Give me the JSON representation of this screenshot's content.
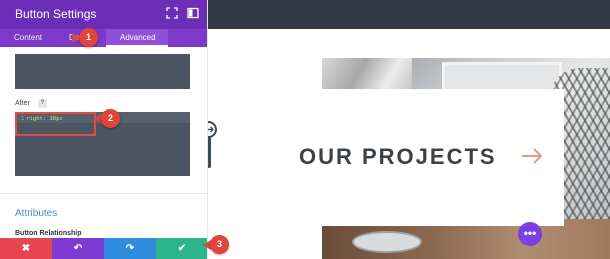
{
  "panel": {
    "title": "Button Settings",
    "header_icons": [
      "expand-icon",
      "sidebar-toggle-icon"
    ],
    "tabs": [
      {
        "label": "Content",
        "active": false
      },
      {
        "label": "De",
        "active": false
      },
      {
        "label": "Advanced",
        "active": true
      }
    ],
    "after_label": "After",
    "help_label": "?",
    "code_line_number": "1",
    "code_text": "right: 30px",
    "attributes_heading": "Attributes",
    "button_relationship_label": "Button Relationship",
    "actions": [
      {
        "name": "discard-button",
        "icon": "close-icon",
        "glyph": "✖",
        "color": "#e8454f"
      },
      {
        "name": "undo-button",
        "icon": "undo-icon",
        "glyph": "↶",
        "color": "#7d3ad0"
      },
      {
        "name": "redo-button",
        "icon": "redo-icon",
        "glyph": "↷",
        "color": "#2d8be0"
      },
      {
        "name": "save-button",
        "icon": "check-icon",
        "glyph": "✔",
        "color": "#2bb58a"
      }
    ]
  },
  "page": {
    "section_title": "OUR PROJECTS",
    "arrow_icon": "arrow-right-icon",
    "fab_label": "•••"
  },
  "callouts": [
    "1",
    "2",
    "3"
  ],
  "colors": {
    "header_purple": "#6c2eb9",
    "tab_purple": "#7d3ac8",
    "accent_blue": "#4a8ccf",
    "callout_red": "#e0443b",
    "arrow_peach": "#e39a7e",
    "fab_purple": "#7b3fe4"
  }
}
